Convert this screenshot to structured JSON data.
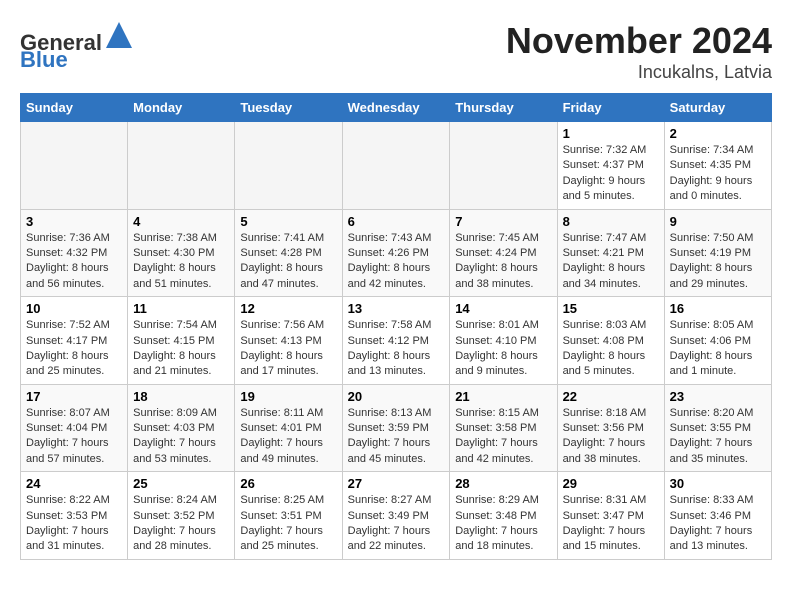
{
  "header": {
    "logo_line1": "General",
    "logo_line2": "Blue",
    "month": "November 2024",
    "location": "Incukalns, Latvia"
  },
  "weekdays": [
    "Sunday",
    "Monday",
    "Tuesday",
    "Wednesday",
    "Thursday",
    "Friday",
    "Saturday"
  ],
  "weeks": [
    [
      {
        "day": "",
        "info": ""
      },
      {
        "day": "",
        "info": ""
      },
      {
        "day": "",
        "info": ""
      },
      {
        "day": "",
        "info": ""
      },
      {
        "day": "",
        "info": ""
      },
      {
        "day": "1",
        "info": "Sunrise: 7:32 AM\nSunset: 4:37 PM\nDaylight: 9 hours\nand 5 minutes."
      },
      {
        "day": "2",
        "info": "Sunrise: 7:34 AM\nSunset: 4:35 PM\nDaylight: 9 hours\nand 0 minutes."
      }
    ],
    [
      {
        "day": "3",
        "info": "Sunrise: 7:36 AM\nSunset: 4:32 PM\nDaylight: 8 hours\nand 56 minutes."
      },
      {
        "day": "4",
        "info": "Sunrise: 7:38 AM\nSunset: 4:30 PM\nDaylight: 8 hours\nand 51 minutes."
      },
      {
        "day": "5",
        "info": "Sunrise: 7:41 AM\nSunset: 4:28 PM\nDaylight: 8 hours\nand 47 minutes."
      },
      {
        "day": "6",
        "info": "Sunrise: 7:43 AM\nSunset: 4:26 PM\nDaylight: 8 hours\nand 42 minutes."
      },
      {
        "day": "7",
        "info": "Sunrise: 7:45 AM\nSunset: 4:24 PM\nDaylight: 8 hours\nand 38 minutes."
      },
      {
        "day": "8",
        "info": "Sunrise: 7:47 AM\nSunset: 4:21 PM\nDaylight: 8 hours\nand 34 minutes."
      },
      {
        "day": "9",
        "info": "Sunrise: 7:50 AM\nSunset: 4:19 PM\nDaylight: 8 hours\nand 29 minutes."
      }
    ],
    [
      {
        "day": "10",
        "info": "Sunrise: 7:52 AM\nSunset: 4:17 PM\nDaylight: 8 hours\nand 25 minutes."
      },
      {
        "day": "11",
        "info": "Sunrise: 7:54 AM\nSunset: 4:15 PM\nDaylight: 8 hours\nand 21 minutes."
      },
      {
        "day": "12",
        "info": "Sunrise: 7:56 AM\nSunset: 4:13 PM\nDaylight: 8 hours\nand 17 minutes."
      },
      {
        "day": "13",
        "info": "Sunrise: 7:58 AM\nSunset: 4:12 PM\nDaylight: 8 hours\nand 13 minutes."
      },
      {
        "day": "14",
        "info": "Sunrise: 8:01 AM\nSunset: 4:10 PM\nDaylight: 8 hours\nand 9 minutes."
      },
      {
        "day": "15",
        "info": "Sunrise: 8:03 AM\nSunset: 4:08 PM\nDaylight: 8 hours\nand 5 minutes."
      },
      {
        "day": "16",
        "info": "Sunrise: 8:05 AM\nSunset: 4:06 PM\nDaylight: 8 hours\nand 1 minute."
      }
    ],
    [
      {
        "day": "17",
        "info": "Sunrise: 8:07 AM\nSunset: 4:04 PM\nDaylight: 7 hours\nand 57 minutes."
      },
      {
        "day": "18",
        "info": "Sunrise: 8:09 AM\nSunset: 4:03 PM\nDaylight: 7 hours\nand 53 minutes."
      },
      {
        "day": "19",
        "info": "Sunrise: 8:11 AM\nSunset: 4:01 PM\nDaylight: 7 hours\nand 49 minutes."
      },
      {
        "day": "20",
        "info": "Sunrise: 8:13 AM\nSunset: 3:59 PM\nDaylight: 7 hours\nand 45 minutes."
      },
      {
        "day": "21",
        "info": "Sunrise: 8:15 AM\nSunset: 3:58 PM\nDaylight: 7 hours\nand 42 minutes."
      },
      {
        "day": "22",
        "info": "Sunrise: 8:18 AM\nSunset: 3:56 PM\nDaylight: 7 hours\nand 38 minutes."
      },
      {
        "day": "23",
        "info": "Sunrise: 8:20 AM\nSunset: 3:55 PM\nDaylight: 7 hours\nand 35 minutes."
      }
    ],
    [
      {
        "day": "24",
        "info": "Sunrise: 8:22 AM\nSunset: 3:53 PM\nDaylight: 7 hours\nand 31 minutes."
      },
      {
        "day": "25",
        "info": "Sunrise: 8:24 AM\nSunset: 3:52 PM\nDaylight: 7 hours\nand 28 minutes."
      },
      {
        "day": "26",
        "info": "Sunrise: 8:25 AM\nSunset: 3:51 PM\nDaylight: 7 hours\nand 25 minutes."
      },
      {
        "day": "27",
        "info": "Sunrise: 8:27 AM\nSunset: 3:49 PM\nDaylight: 7 hours\nand 22 minutes."
      },
      {
        "day": "28",
        "info": "Sunrise: 8:29 AM\nSunset: 3:48 PM\nDaylight: 7 hours\nand 18 minutes."
      },
      {
        "day": "29",
        "info": "Sunrise: 8:31 AM\nSunset: 3:47 PM\nDaylight: 7 hours\nand 15 minutes."
      },
      {
        "day": "30",
        "info": "Sunrise: 8:33 AM\nSunset: 3:46 PM\nDaylight: 7 hours\nand 13 minutes."
      }
    ]
  ]
}
